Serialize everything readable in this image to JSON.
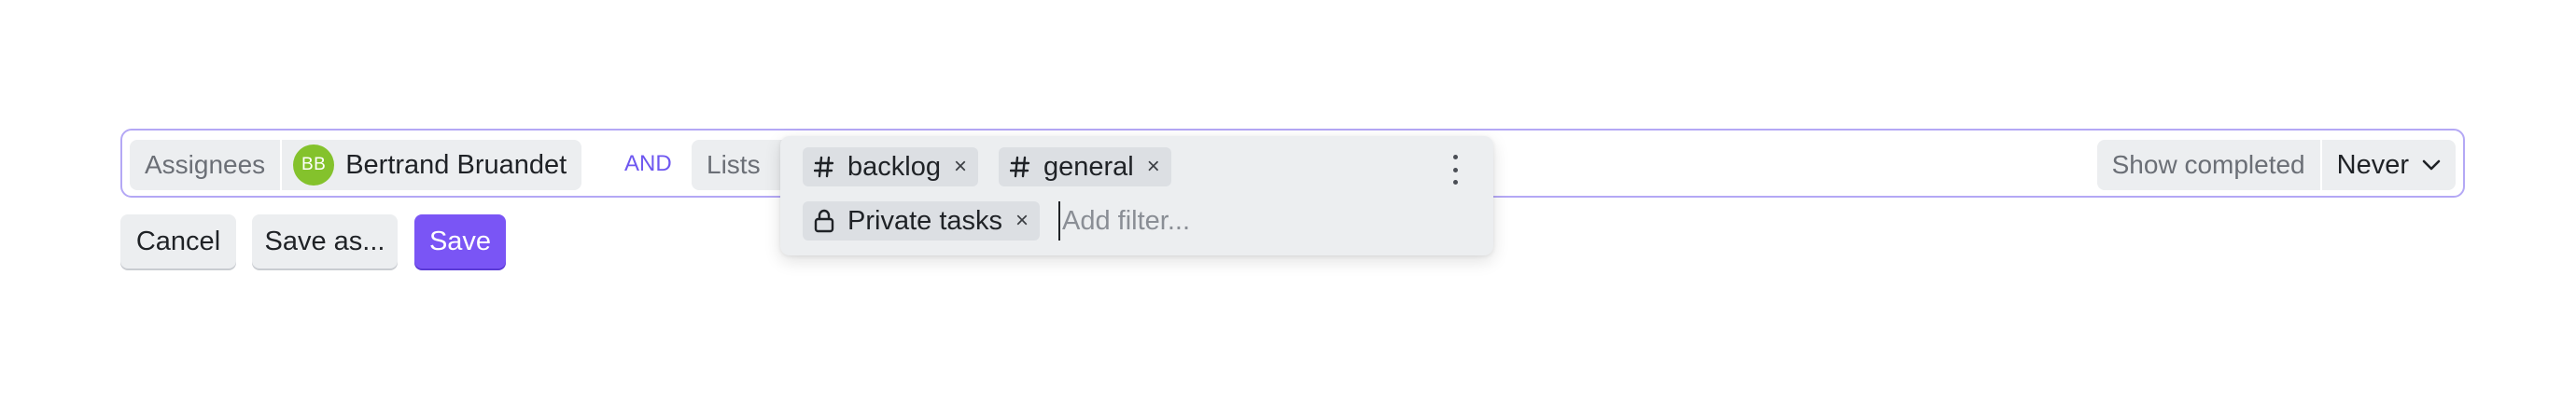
{
  "filter_bar": {
    "assignees": {
      "label": "Assignees",
      "user": {
        "initials": "BB",
        "name": "Bertrand Bruandet",
        "avatar_color": "#84c22c"
      }
    },
    "operator": "AND",
    "lists": {
      "label": "Lists"
    },
    "show_completed": {
      "label": "Show completed",
      "value": "Never"
    }
  },
  "lists_popup": {
    "tags": [
      {
        "icon": "hash-icon",
        "label": "backlog"
      },
      {
        "icon": "hash-icon",
        "label": "general"
      },
      {
        "icon": "lock-icon",
        "label": "Private tasks"
      }
    ],
    "remove_glyph": "×",
    "input_placeholder": "Add filter..."
  },
  "actions": {
    "cancel": "Cancel",
    "save_as": "Save as...",
    "save": "Save"
  },
  "colors": {
    "accent": "#7a55f5",
    "focus_border": "#b4a8f5",
    "operator": "#6e57f0"
  }
}
